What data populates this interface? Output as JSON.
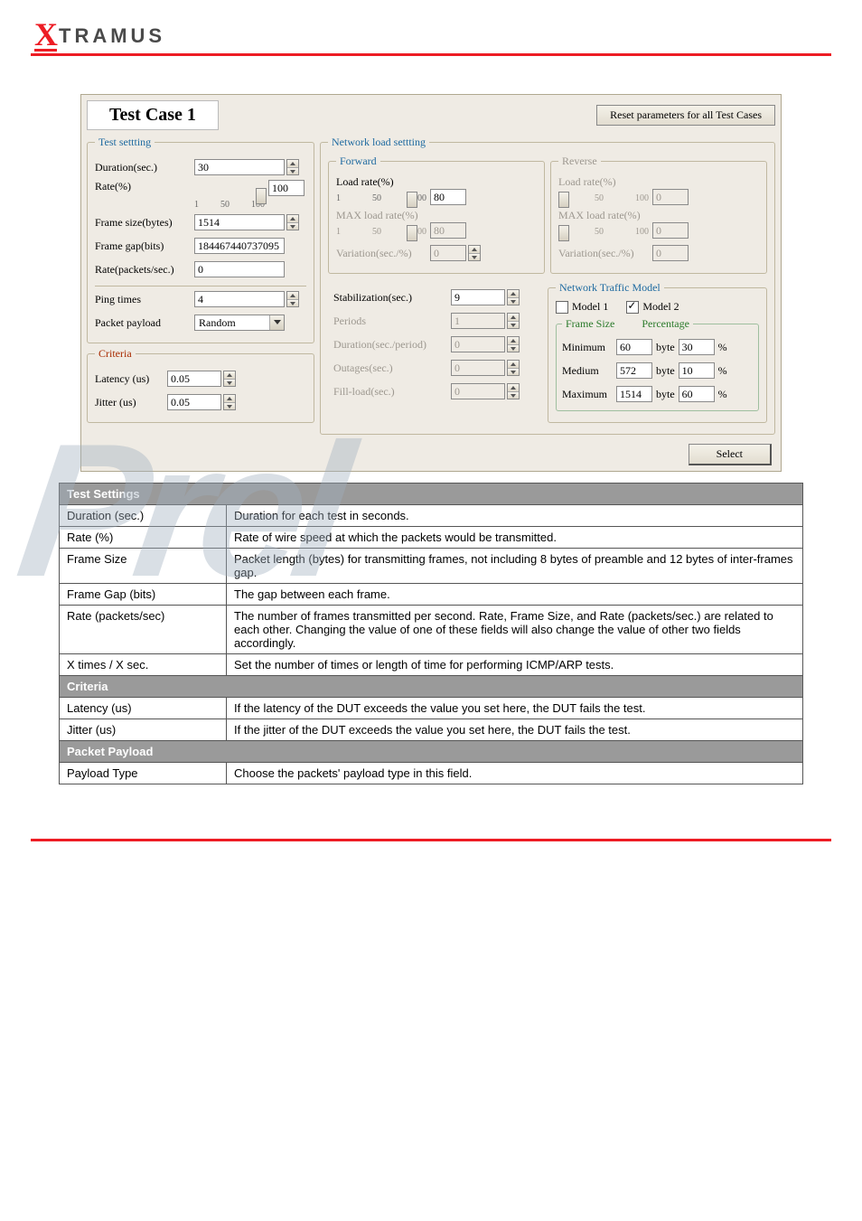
{
  "logo": {
    "x": "X",
    "rest": "TRAMUS"
  },
  "panel": {
    "title": "Test Case 1",
    "reset_btn": "Reset parameters for all Test Cases",
    "test_setting": {
      "legend": "Test settting",
      "duration_label": "Duration(sec.)",
      "duration_value": "30",
      "rate_label": "Rate(%)",
      "rate_value": "100",
      "rate_ticks": [
        "1",
        "50",
        "100"
      ],
      "frame_size_label": "Frame size(bytes)",
      "frame_size_value": "1514",
      "frame_gap_label": "Frame gap(bits)",
      "frame_gap_value": "184467440737095",
      "rate_pps_label": "Rate(packets/sec.)",
      "rate_pps_value": "0",
      "ping_label": "Ping times",
      "ping_value": "4",
      "payload_label": "Packet payload",
      "payload_value": "Random"
    },
    "criteria": {
      "legend": "Criteria",
      "latency_label": "Latency (us)",
      "latency_value": "0.05",
      "jitter_label": "Jitter (us)",
      "jitter_value": "0.05"
    },
    "network_load": {
      "legend": "Network load settting",
      "forward": {
        "legend": "Forward",
        "load_rate_label": "Load rate(%)",
        "load_rate_value": "80",
        "load_ticks": [
          "1",
          "50",
          "100"
        ],
        "max_load_rate_label": "MAX load rate(%)",
        "max_load_rate_value": "80",
        "max_ticks": [
          "1",
          "50",
          "100"
        ],
        "variation_label": "Variation(sec./%)",
        "variation_value": "0"
      },
      "reverse": {
        "legend": "Reverse",
        "load_rate_label": "Load rate(%)",
        "load_rate_value": "0",
        "load_ticks": [
          "1",
          "50",
          "100"
        ],
        "max_load_rate_label": "MAX load rate(%)",
        "max_load_rate_value": "0",
        "max_ticks": [
          "1",
          "50",
          "100"
        ],
        "variation_label": "Variation(sec./%)",
        "variation_value": "0"
      },
      "stabilization_label": "Stabilization(sec.)",
      "stabilization_value": "9",
      "periods_label": "Periods",
      "periods_value": "1",
      "dur_per_period_label": "Duration(sec./period)",
      "dur_per_period_value": "0",
      "outages_label": "Outages(sec.)",
      "outages_value": "0",
      "fill_load_label": "Fill-load(sec.)",
      "fill_load_value": "0"
    },
    "ntm": {
      "legend": "Network Traffic Model",
      "model1_label": "Model 1",
      "model2_label": "Model 2",
      "col_frame": "Frame Size",
      "col_percent": "Percentage",
      "rows": [
        {
          "name": "Minimum",
          "bytes": "60",
          "unit": "byte",
          "pct": "30",
          "pct_unit": "%"
        },
        {
          "name": "Medium",
          "bytes": "572",
          "unit": "byte",
          "pct": "10",
          "pct_unit": "%"
        },
        {
          "name": "Maximum",
          "bytes": "1514",
          "unit": "byte",
          "pct": "60",
          "pct_unit": "%"
        }
      ]
    },
    "select_btn": "Select"
  },
  "desc_table": {
    "sections": [
      {
        "header": "Test Settings",
        "rows": [
          {
            "k": "Duration (sec.)",
            "v": "Duration for each test in seconds."
          },
          {
            "k": "Rate (%)",
            "v": "Rate of wire speed at which the packets would be transmitted."
          },
          {
            "k": "Frame Size",
            "v": "Packet length (bytes) for transmitting frames, not including 8 bytes of preamble and 12 bytes of inter-frames gap."
          },
          {
            "k": "Frame Gap (bits)",
            "v": "The gap between each frame."
          },
          {
            "k": "Rate (packets/sec)",
            "v": "The number of frames transmitted per second. Rate, Frame Size, and Rate (packets/sec.) are related to each other. Changing the value of one of these fields will also change the value of other two fields accordingly."
          },
          {
            "k": "X times / X sec.",
            "v": "Set the number of times or length of time for performing ICMP/ARP tests."
          }
        ]
      },
      {
        "header": "Criteria",
        "rows": [
          {
            "k": "Latency (us)",
            "v": "If the latency of the DUT exceeds the value you set here, the DUT fails the test."
          },
          {
            "k": "Jitter (us)",
            "v": "If the jitter of the DUT exceeds the value you set here, the DUT fails the test."
          }
        ]
      },
      {
        "header": "Packet Payload",
        "rows": [
          {
            "k": "Payload Type",
            "v": "Choose the packets' payload type in this field."
          }
        ]
      }
    ]
  },
  "watermark": "Prel"
}
